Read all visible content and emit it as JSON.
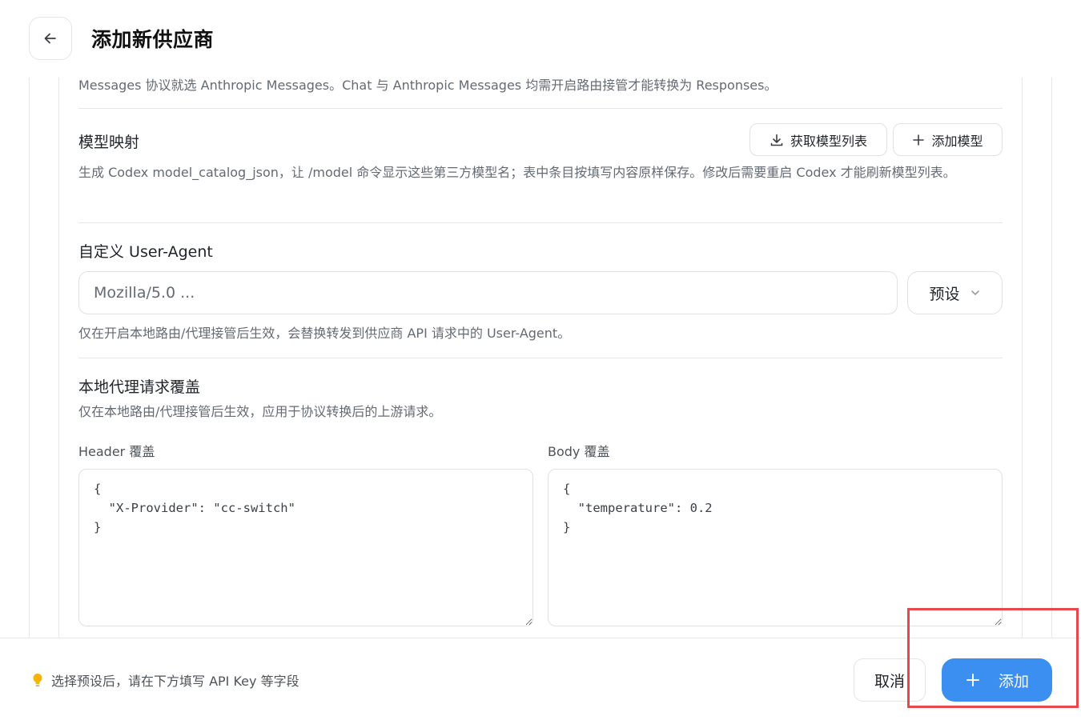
{
  "header": {
    "title": "添加新供应商"
  },
  "top_note": "Messages 协议就选 Anthropic Messages。Chat 与 Anthropic Messages 均需开启路由接管才能转换为 Responses。",
  "model_mapping": {
    "title": "模型映射",
    "fetch_button": "获取模型列表",
    "add_button": "添加模型",
    "description": "生成 Codex model_catalog_json，让 /model 命令显示这些第三方模型名；表中条目按填写内容原样保存。修改后需要重启 Codex 才能刷新模型列表。"
  },
  "user_agent": {
    "title": "自定义 User-Agent",
    "placeholder": "Mozilla/5.0 ...",
    "preset_button": "预设",
    "description": "仅在开启本地路由/代理接管后生效，会替换转发到供应商 API 请求中的 User-Agent。"
  },
  "proxy_override": {
    "title": "本地代理请求覆盖",
    "description": "仅在本地路由/代理接管后生效，应用于协议转换后的上游请求。",
    "header_label": "Header 覆盖",
    "header_value": "{\n  \"X-Provider\": \"cc-switch\"\n}",
    "body_label": "Body 覆盖",
    "body_value": "{\n  \"temperature\": 0.2\n}"
  },
  "footer": {
    "hint": "选择预设后，请在下方填写 API Key 等字段",
    "cancel_label": "取消",
    "add_label": "添加"
  },
  "colors": {
    "primary": "#3a8ff0",
    "highlight": "#e8484a",
    "hint_icon": "#f5b400"
  },
  "icons": [
    "arrow-left-icon",
    "download-icon",
    "plus-icon",
    "chevron-down-icon",
    "lightbulb-icon"
  ]
}
